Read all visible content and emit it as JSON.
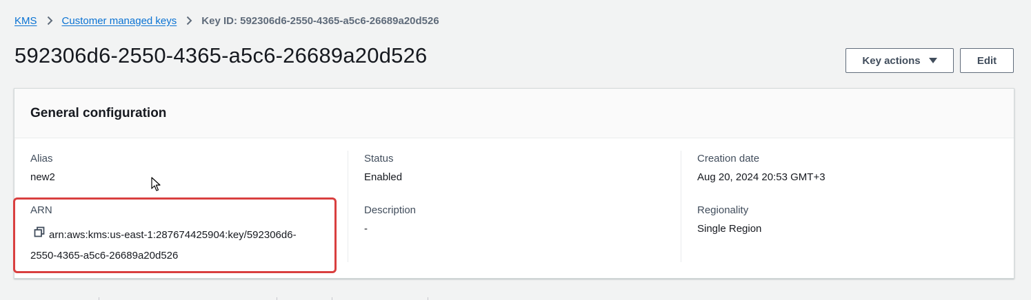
{
  "breadcrumb": {
    "items": [
      "KMS",
      "Customer managed keys"
    ],
    "current": "Key ID: 592306d6-2550-4365-a5c6-26689a20d526"
  },
  "header": {
    "title": "592306d6-2550-4365-a5c6-26689a20d526",
    "key_actions_label": "Key actions",
    "edit_label": "Edit"
  },
  "general_config": {
    "title": "General configuration",
    "alias": {
      "label": "Alias",
      "value": "new2"
    },
    "arn": {
      "label": "ARN",
      "line1": "arn:aws:kms:us-east-1:287674425904:key/592306d6-",
      "line2": "2550-4365-a5c6-26689a20d526"
    },
    "status": {
      "label": "Status",
      "value": "Enabled"
    },
    "description": {
      "label": "Description",
      "value": "-"
    },
    "creation_date": {
      "label": "Creation date",
      "value": "Aug 20, 2024 20:53 GMT+3"
    },
    "regionality": {
      "label": "Regionality",
      "value": "Single Region"
    }
  },
  "icons": {
    "breadcrumb_separator": "chevron-right-icon",
    "dropdown": "caret-down-icon",
    "copy": "copy-icon",
    "cursor": "mouse-pointer-icon"
  },
  "colors": {
    "link": "#0972d3",
    "highlight": "#d93f3f",
    "background": "#f2f3f3"
  }
}
